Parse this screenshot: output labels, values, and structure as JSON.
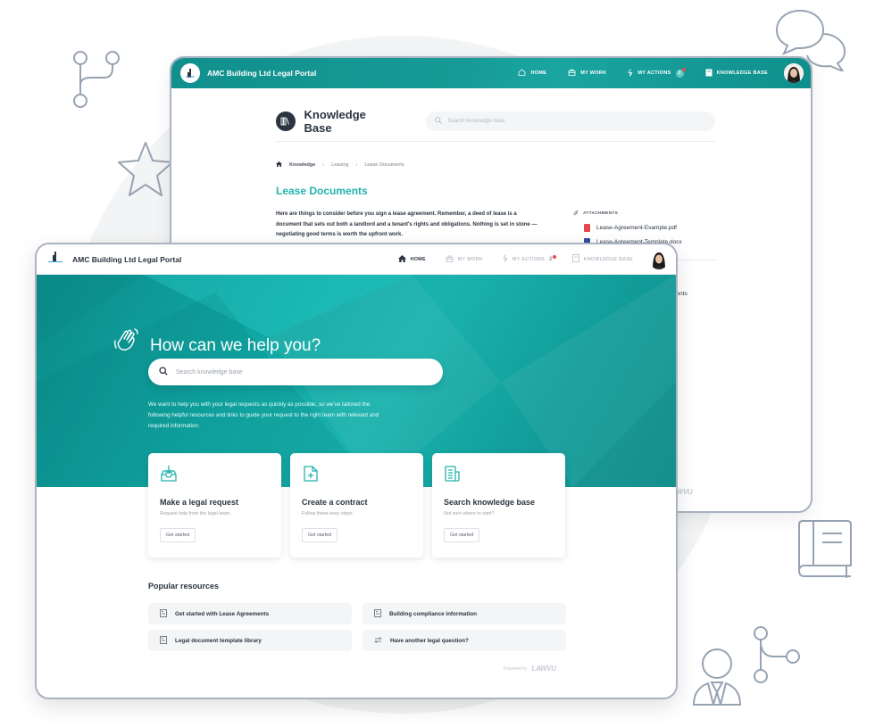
{
  "back_window": {
    "brand": "AMC Building Ltd Legal Portal",
    "nav": [
      {
        "label": "HOME",
        "icon": "home-outline-icon"
      },
      {
        "label": "MY WORK",
        "icon": "briefcase-icon"
      },
      {
        "label": "MY ACTIONS",
        "icon": "lightning-icon",
        "badge": "2"
      },
      {
        "label": "KNOWLEDGE BASE",
        "icon": "book-icon"
      }
    ],
    "kb_title": "Knowledge Base",
    "kb_search_placeholder": "Search knowledge base",
    "breadcrumb": [
      "Knowledge",
      "Leasing",
      "Lease Documents"
    ],
    "doc_title": "Lease Documents",
    "doc_body": "Here are things to consider before you sign a lease agreement. Remember, a deed of lease is a document that sets out both a landlord and a tenant's rights and obligations. Nothing is set in stone — negotiating good terms is worth the upfront work.",
    "attachments_label": "ATTACHMENTS",
    "attachments": [
      {
        "name": "Lease-Agreement-Example.pdf",
        "type": "pdf"
      },
      {
        "name": "Lease-Agreement-Template.docx",
        "type": "docx"
      }
    ],
    "partial_text": "ments",
    "footer_logo": "LAWVU"
  },
  "front_window": {
    "brand": "AMC Building Ltd Legal Portal",
    "nav": [
      {
        "label": "HOME",
        "icon": "home-icon",
        "active": true
      },
      {
        "label": "MY WORK",
        "icon": "briefcase-icon"
      },
      {
        "label": "MY ACTIONS",
        "icon": "lightning-icon",
        "badge": "2"
      },
      {
        "label": "KNOWLEDGE BASE",
        "icon": "book-icon"
      }
    ],
    "hero": {
      "title": "How can we help you?",
      "search_placeholder": "Search knowledge base",
      "description": "We want to help you with your legal requests as quickly as possible, so we've tailored the following helpful resources and links to guide your request to the right team with relevant and required information."
    },
    "cards": [
      {
        "title": "Make a legal request",
        "subtitle": "Request help from the legal team.",
        "button": "Get started",
        "icon": "inbox-tray-icon"
      },
      {
        "title": "Create a contract",
        "subtitle": "Follow these easy steps.",
        "button": "Get started",
        "icon": "document-plus-icon"
      },
      {
        "title": "Search knowledge base",
        "subtitle": "Not sure where to start?",
        "button": "Get started",
        "icon": "newspaper-icon"
      }
    ],
    "popular_title": "Popular resources",
    "popular": [
      {
        "label": "Get started with Lease Agreements",
        "icon": "article-icon"
      },
      {
        "label": "Building compliance information",
        "icon": "article-icon"
      },
      {
        "label": "Legal document template library",
        "icon": "article-icon"
      },
      {
        "label": "Have another legal question?",
        "icon": "swap-arrows-icon"
      }
    ],
    "powered_by": "Powered by",
    "powered_logo": "LAWVU"
  },
  "colors": {
    "teal": "#14a39f",
    "teal_dark": "#0a8b89",
    "title_teal": "#23b3ac",
    "text_dark": "#2b3440",
    "deco_stroke": "#97a3b3",
    "notification_dot": "#e5484d"
  }
}
